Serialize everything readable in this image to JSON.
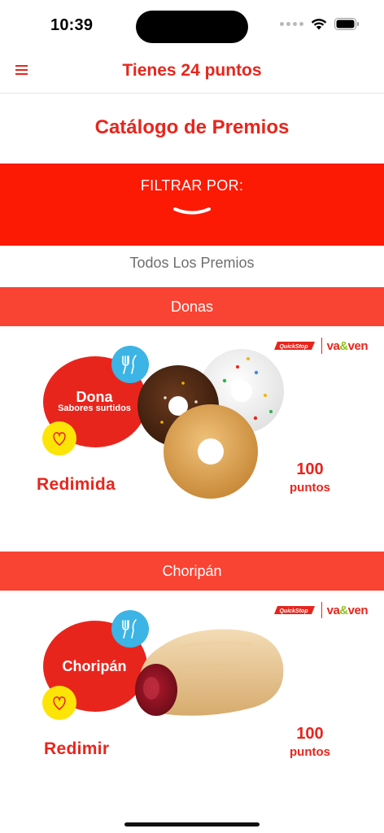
{
  "status_bar": {
    "time": "10:39"
  },
  "header": {
    "menu_icon": "hamburger-icon",
    "title": "Tienes 24 puntos"
  },
  "catalog": {
    "title": "Catálogo de Premios"
  },
  "filter": {
    "label": "FILTRAR POR:",
    "icon": "chevron-down-icon"
  },
  "all_prizes_label": "Todos Los Premios",
  "colors": {
    "brand_red": "#e8251c",
    "filter_red": "#fd1a05",
    "category_red": "#f94333",
    "badge_blue": "#3cb4e5",
    "badge_yellow": "#fde407"
  },
  "rewards": [
    {
      "category": "Donas",
      "brands": {
        "quick": "QuickStop",
        "vaven_prefix": "va",
        "vaven_amp": "&",
        "vaven_suffix": "ven"
      },
      "product_title": "Dona",
      "product_subtitle": "Sabores surtidos",
      "action": "Redimida",
      "points": "100",
      "points_unit": "puntos"
    },
    {
      "category": "Choripán",
      "brands": {
        "quick": "QuickStop",
        "vaven_prefix": "va",
        "vaven_amp": "&",
        "vaven_suffix": "ven"
      },
      "product_title": "Choripán",
      "product_subtitle": "",
      "action": "Redimir",
      "points": "100",
      "points_unit": "puntos"
    }
  ]
}
